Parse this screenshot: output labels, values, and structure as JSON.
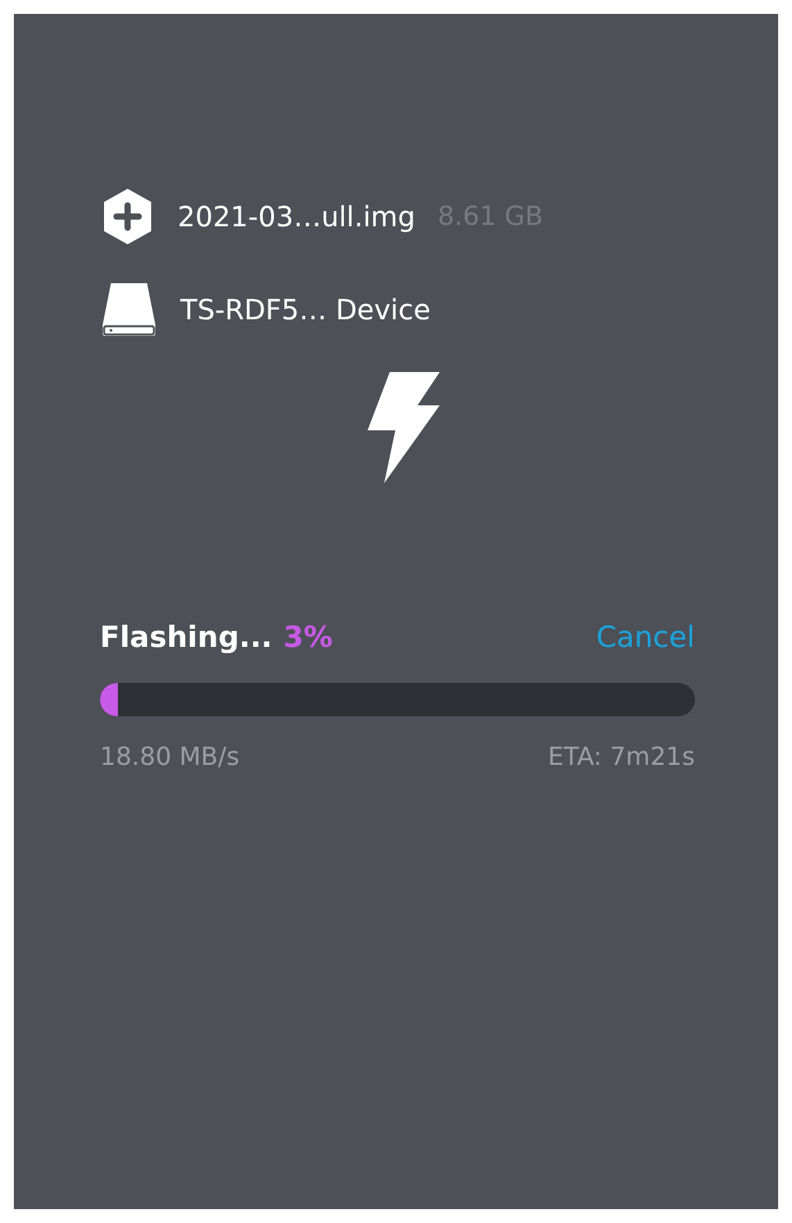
{
  "source": {
    "name": "2021-03…ull.img",
    "size": "8.61 GB"
  },
  "target": {
    "name": "TS-RDF5… Device"
  },
  "progress": {
    "status": "Flashing...",
    "percent": "3%",
    "level": 0.03,
    "cancel": "Cancel",
    "speed": "18.80 MB/s",
    "eta": "ETA: 7m21s"
  }
}
